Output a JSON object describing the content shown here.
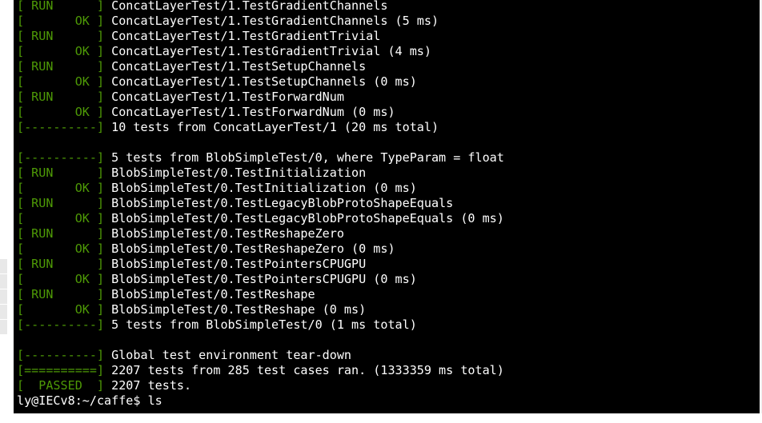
{
  "terminal": {
    "lines": [
      {
        "tag": "[ RUN      ]",
        "text": " ConcatLayerTest/1.TestGradientChannels"
      },
      {
        "tag": "[       OK ]",
        "text": " ConcatLayerTest/1.TestGradientChannels (5 ms)"
      },
      {
        "tag": "[ RUN      ]",
        "text": " ConcatLayerTest/1.TestGradientTrivial"
      },
      {
        "tag": "[       OK ]",
        "text": " ConcatLayerTest/1.TestGradientTrivial (4 ms)"
      },
      {
        "tag": "[ RUN      ]",
        "text": " ConcatLayerTest/1.TestSetupChannels"
      },
      {
        "tag": "[       OK ]",
        "text": " ConcatLayerTest/1.TestSetupChannels (0 ms)"
      },
      {
        "tag": "[ RUN      ]",
        "text": " ConcatLayerTest/1.TestForwardNum"
      },
      {
        "tag": "[       OK ]",
        "text": " ConcatLayerTest/1.TestForwardNum (0 ms)"
      },
      {
        "tag": "[----------]",
        "text": " 10 tests from ConcatLayerTest/1 (20 ms total)"
      },
      {
        "tag": "",
        "text": ""
      },
      {
        "tag": "[----------]",
        "text": " 5 tests from BlobSimpleTest/0, where TypeParam = float"
      },
      {
        "tag": "[ RUN      ]",
        "text": " BlobSimpleTest/0.TestInitialization"
      },
      {
        "tag": "[       OK ]",
        "text": " BlobSimpleTest/0.TestInitialization (0 ms)"
      },
      {
        "tag": "[ RUN      ]",
        "text": " BlobSimpleTest/0.TestLegacyBlobProtoShapeEquals"
      },
      {
        "tag": "[       OK ]",
        "text": " BlobSimpleTest/0.TestLegacyBlobProtoShapeEquals (0 ms)"
      },
      {
        "tag": "[ RUN      ]",
        "text": " BlobSimpleTest/0.TestReshapeZero"
      },
      {
        "tag": "[       OK ]",
        "text": " BlobSimpleTest/0.TestReshapeZero (0 ms)"
      },
      {
        "tag": "[ RUN      ]",
        "text": " BlobSimpleTest/0.TestPointersCPUGPU"
      },
      {
        "tag": "[       OK ]",
        "text": " BlobSimpleTest/0.TestPointersCPUGPU (0 ms)"
      },
      {
        "tag": "[ RUN      ]",
        "text": " BlobSimpleTest/0.TestReshape"
      },
      {
        "tag": "[       OK ]",
        "text": " BlobSimpleTest/0.TestReshape (0 ms)"
      },
      {
        "tag": "[----------]",
        "text": " 5 tests from BlobSimpleTest/0 (1 ms total)"
      },
      {
        "tag": "",
        "text": ""
      },
      {
        "tag": "[----------]",
        "text": " Global test environment tear-down"
      },
      {
        "tag": "[==========]",
        "text": " 2207 tests from 285 test cases ran. (1333359 ms total)"
      },
      {
        "tag": "[  PASSED  ]",
        "text": " 2207 tests."
      },
      {
        "tag": "",
        "text": "ly@IECv8:~/caffe$ ls"
      }
    ]
  },
  "colors": {
    "background": "#000000",
    "text": "#ffffff",
    "tag": "#4e9a06"
  }
}
